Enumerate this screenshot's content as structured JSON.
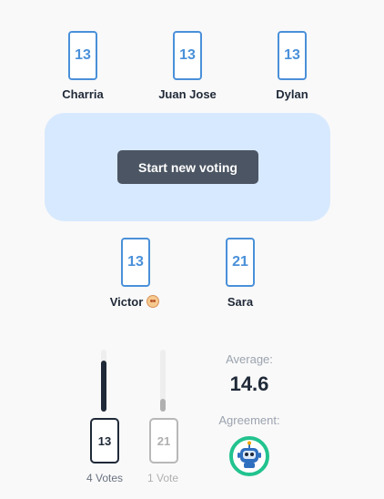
{
  "players_top": [
    {
      "name": "Charria",
      "card": "13"
    },
    {
      "name": "Juan Jose",
      "card": "13"
    },
    {
      "name": "Dylan",
      "card": "13"
    }
  ],
  "players_bottom": [
    {
      "name": "Victor",
      "card": "13",
      "emoji": "hot-face-emoji"
    },
    {
      "name": "Sara",
      "card": "21"
    }
  ],
  "table": {
    "start_label": "Start new voting"
  },
  "results": [
    {
      "card": "13",
      "votes_label": "4 Votes",
      "votes": 4,
      "share": 0.8
    },
    {
      "card": "21",
      "votes_label": "1 Vote",
      "votes": 1,
      "share": 0.2
    }
  ],
  "stats": {
    "average_label": "Average:",
    "average_value": "14.6",
    "agreement_label": "Agreement:",
    "agreement_icon": "robot-icon"
  },
  "colors": {
    "card_accent": "#4a90d9",
    "table_bg": "#d7e9ff",
    "button_bg": "#4b5563",
    "bar_dark": "#1f2937",
    "bar_light": "#b0b0b0",
    "agreement_ring": "#22c38e"
  }
}
